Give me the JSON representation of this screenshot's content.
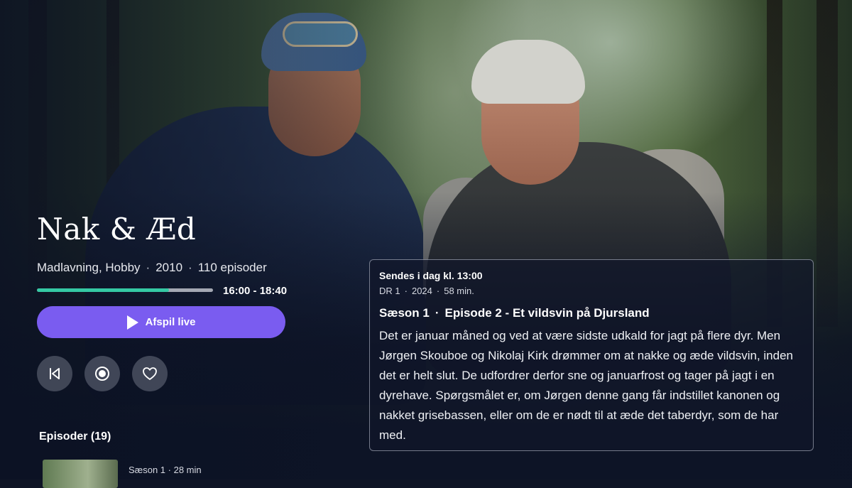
{
  "show": {
    "title": "Nak & Æd",
    "genres": "Madlavning, Hobby",
    "year": "2010",
    "episode_count": "110 episoder",
    "separator": "·",
    "time_range": "16:00 - 18:40",
    "live_progress": 0.75
  },
  "actions": {
    "play_label": "Afspil live",
    "buttons": [
      "restart-icon",
      "record-icon",
      "heart-icon"
    ]
  },
  "episodes": {
    "heading": "Episoder (19)",
    "first_item_meta": "Sæson 1 · 28 min"
  },
  "details": {
    "airing": "Sendes i dag kl. 13:00",
    "channel": "DR 1",
    "year": "2024",
    "duration": "58 min.",
    "separator": "·",
    "season": "Sæson 1",
    "episode": "Episode 2 - Et vildsvin på Djursland",
    "description": "Det er januar måned og ved at være sidste udkald for jagt på flere dyr. Men Jørgen Skouboe og Nikolaj Kirk drømmer om at nakke og æde vildsvin, inden det er helt slut. De udfordrer derfor sne og januarfrost og tager på jagt i en dyrehave. Spørgsmålet er, om Jørgen denne gang får indstillet kanonen og nakket grisebassen, eller om de er nødt til at æde det taberdyr, som de har med."
  },
  "colors": {
    "accent_purple": "#7a5cf0",
    "progress_green": "#35c9a4",
    "background": "#0d1426"
  }
}
